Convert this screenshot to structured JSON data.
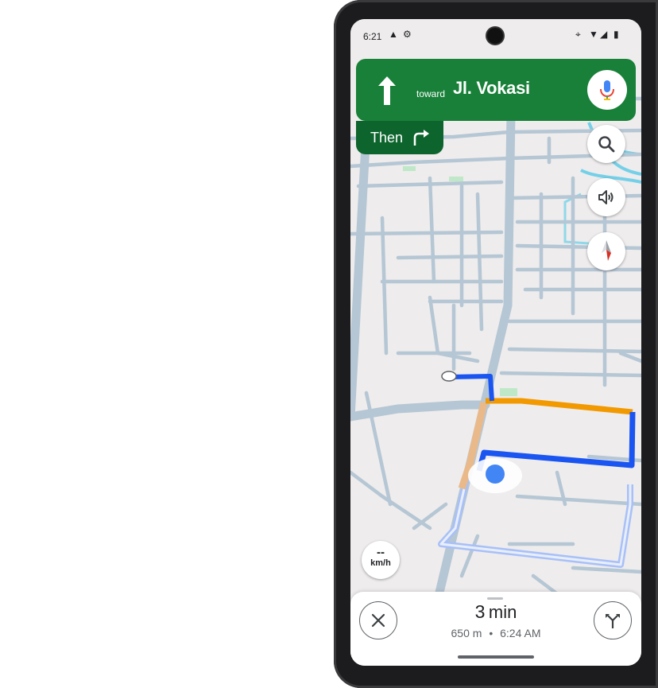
{
  "status_bar": {
    "time": "6:21",
    "icons": [
      "navigation-arrow-icon",
      "settings-gear-icon",
      "location-pin-icon",
      "wifi-icon",
      "cell-signal-icon",
      "battery-icon"
    ]
  },
  "navigation": {
    "direction_icon": "straight-arrow-icon",
    "toward_label": "toward",
    "street_name": "Jl. Vokasi",
    "then_label": "Then",
    "then_icon": "turn-right-icon",
    "banner_color": "#188038",
    "then_color": "#0d652d"
  },
  "map_controls": {
    "search_icon": "search-icon",
    "sound_icon": "volume-icon",
    "compass_icon": "compass-icon"
  },
  "speedometer": {
    "value": "--",
    "unit": "km/h"
  },
  "trip": {
    "duration_value": "3",
    "duration_unit": "min",
    "distance": "650 m",
    "separator": "•",
    "arrival": "6:24 AM"
  },
  "route_colors": {
    "primary": "#1a55f2",
    "traffic": "#f29900",
    "alternate": "#a8c0f7",
    "location_dot": "#4285f4"
  }
}
